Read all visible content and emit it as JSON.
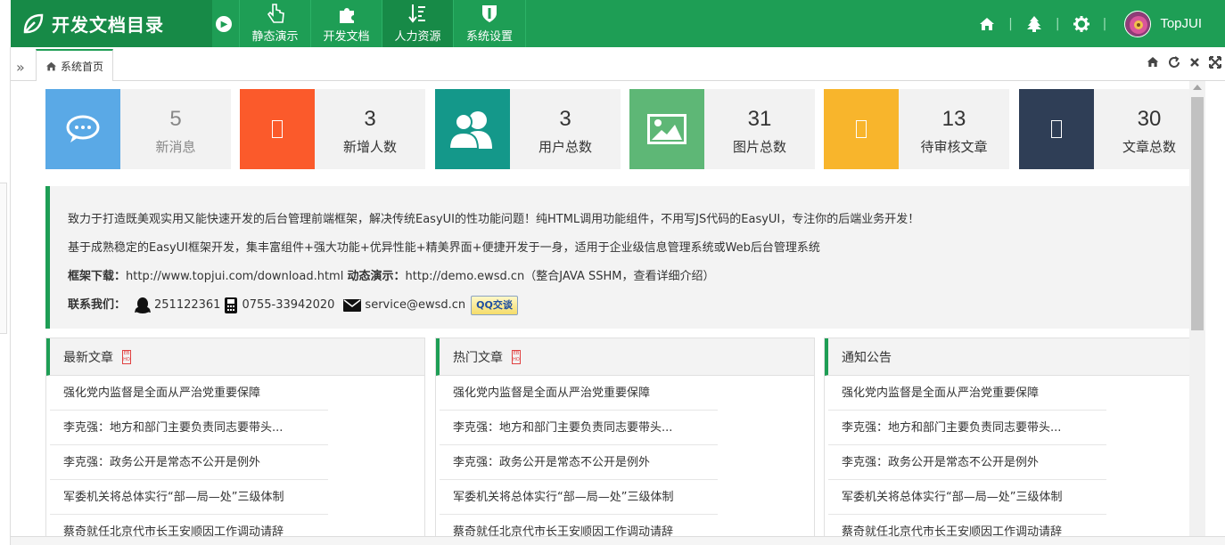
{
  "header": {
    "app_title": "开发文档目录",
    "menu": [
      {
        "label": "静态演示",
        "icon": "hand-pointer-icon"
      },
      {
        "label": "开发文档",
        "icon": "puzzle-icon"
      },
      {
        "label": "人力资源",
        "icon": "sort-icon"
      },
      {
        "label": "系统设置",
        "icon": "shield-icon"
      }
    ],
    "username": "TopJUI",
    "brand_color": "#1e9e55"
  },
  "tabs": {
    "home_label": "系统首页"
  },
  "stats": [
    {
      "value": "5",
      "label": "新消息",
      "color": "#5aa9e6",
      "icon": "chat-icon"
    },
    {
      "value": "3",
      "label": "新增人数",
      "color": "#fb5a2b",
      "icon": "broken-image-icon"
    },
    {
      "value": "3",
      "label": "用户总数",
      "color": "#14988a",
      "icon": "users-icon"
    },
    {
      "value": "31",
      "label": "图片总数",
      "color": "#5eb776",
      "icon": "picture-icon"
    },
    {
      "value": "13",
      "label": "待审核文章",
      "color": "#f8b52c",
      "icon": "broken-image-icon"
    },
    {
      "value": "30",
      "label": "文章总数",
      "color": "#2f3e56",
      "icon": "broken-image-icon"
    }
  ],
  "intro": {
    "line1": "致力于打造既美观实用又能快速开发的后台管理前端框架，解决传统EasyUI的性功能问题！纯HTML调用功能组件，不用写JS代码的EasyUI，专注你的后端业务开发！",
    "line2": "基于成熟稳定的EasyUI框架开发，集丰富组件+强大功能+优异性能+精美界面+便捷开发于一身，适用于企业级信息管理系统或Web后台管理系统",
    "download_label": "框架下载：",
    "download_url": "http://www.topjui.com/download.html",
    "demo_label": "动态演示：",
    "demo_url": "http://demo.ewsd.cn",
    "demo_note": "（整合JAVA SSHM，查看详细介绍）",
    "contact_label": "联系我们：",
    "qq": "251122361",
    "phone": "0755-33942020",
    "email": "service@ewsd.cn",
    "qq_button": "QQ交谈"
  },
  "panels": [
    {
      "title": "最新文章",
      "items": [
        "强化党内监督是全面从严治党重要保障",
        "李克强：地方和部门主要负责同志要带头...",
        "李克强：政务公开是常态不公开是例外",
        "军委机关将总体实行“部—局—处”三级体制",
        "蔡奇就任北京代市长王安顺因工作调动请辞"
      ]
    },
    {
      "title": "热门文章",
      "items": [
        "强化党内监督是全面从严治党重要保障",
        "李克强：地方和部门主要负责同志要带头...",
        "李克强：政务公开是常态不公开是例外",
        "军委机关将总体实行“部—局—处”三级体制",
        "蔡奇就任北京代市长王安顺因工作调动请辞"
      ]
    },
    {
      "title": "通知公告",
      "items": [
        "强化党内监督是全面从严治党重要保障",
        "李克强：地方和部门主要负责同志要带头...",
        "李克强：政务公开是常态不公开是例外",
        "军委机关将总体实行“部—局—处”三级体制",
        "蔡奇就任北京代市长王安顺因工作调动请辞"
      ]
    }
  ]
}
